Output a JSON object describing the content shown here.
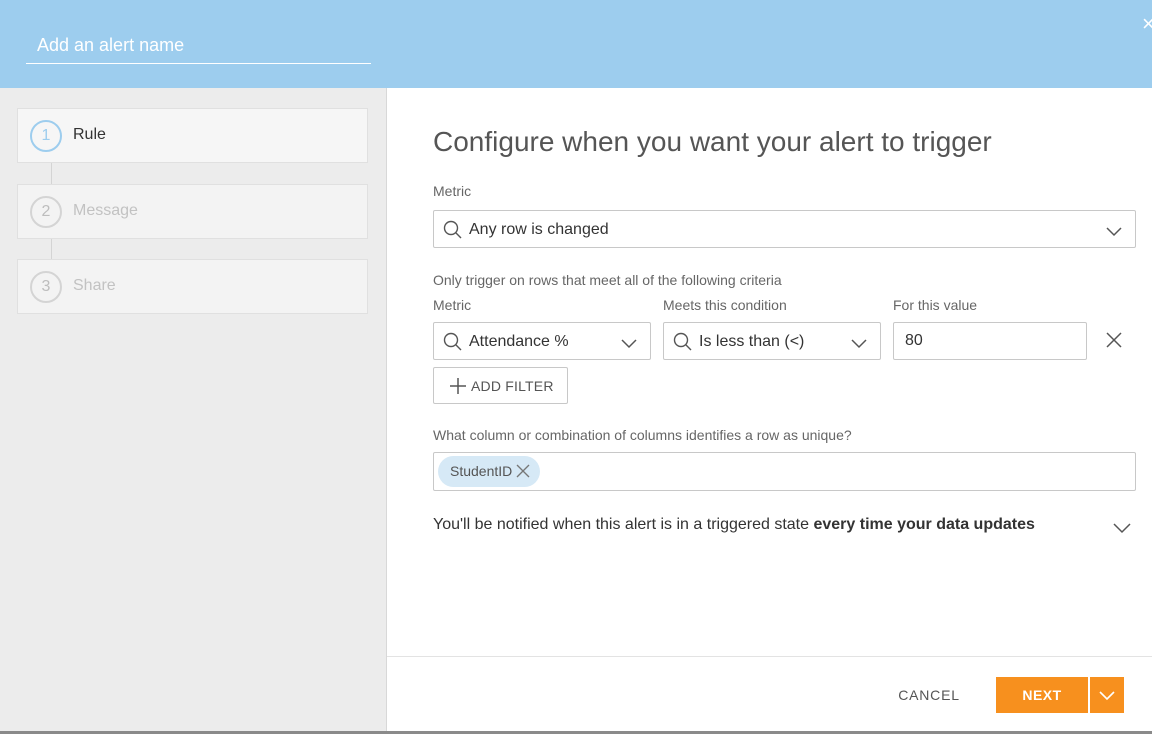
{
  "header": {
    "alert_name_placeholder": "Add an alert name",
    "close_icon": "close-icon"
  },
  "steps": [
    {
      "number": "1",
      "label": "Rule",
      "active": true
    },
    {
      "number": "2",
      "label": "Message",
      "active": false
    },
    {
      "number": "3",
      "label": "Share",
      "active": false
    }
  ],
  "main": {
    "title": "Configure when you want your alert to trigger",
    "metric_label": "Metric",
    "metric_value": "Any row is changed",
    "criteria_label": "Only trigger on rows that meet all of the following criteria",
    "filter": {
      "metric_label": "Metric",
      "metric_value": "Attendance %",
      "condition_label": "Meets this condition",
      "condition_value": "Is less than (<)",
      "value_label": "For this value",
      "value": "80"
    },
    "add_filter_label": "ADD FILTER",
    "unique_label": "What column or combination of columns identifies a row as unique?",
    "unique_chip": "StudentID",
    "notify_prefix": "You'll be notified when this alert is in a triggered state ",
    "notify_emphasis": "every time your data updates"
  },
  "footer": {
    "cancel_label": "CANCEL",
    "next_label": "NEXT"
  },
  "colors": {
    "header_bg": "#9dcdee",
    "accent_orange": "#f7901e",
    "chip_bg": "#d6e9f6",
    "sidebar_bg": "#ececec"
  }
}
